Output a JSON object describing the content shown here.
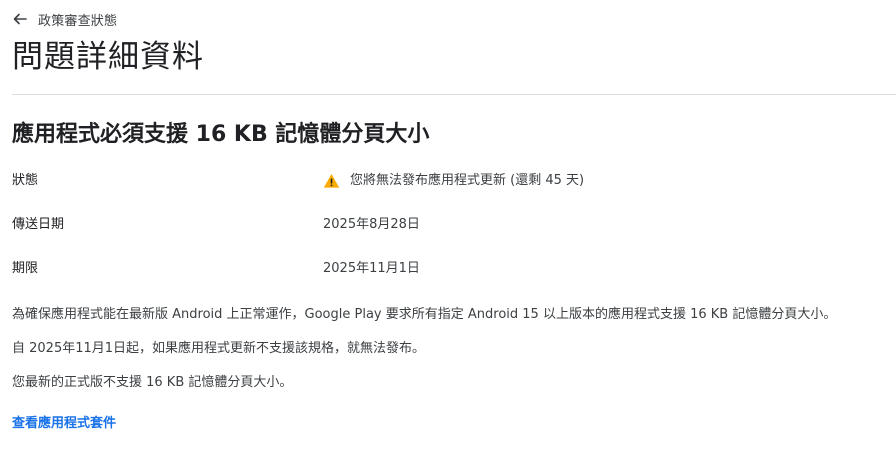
{
  "header": {
    "back_label": "政策審查狀態",
    "title": "問題詳細資料"
  },
  "issue": {
    "title": "應用程式必須支援 16 KB 記憶體分頁大小",
    "rows": [
      {
        "label": "狀態",
        "value": "您將無法發布應用程式更新 (還剩 45 天)"
      },
      {
        "label": "傳送日期",
        "value": "2025年8月28日"
      },
      {
        "label": "期限",
        "value": "2025年11月1日"
      }
    ],
    "paragraphs": [
      "為確保應用程式能在最新版 Android 上正常運作，Google Play 要求所有指定 Android 15 以上版本的應用程式支援 16 KB 記憶體分頁大小。",
      "自 2025年11月1日起，如果應用程式更新不支援該規格，就無法發布。",
      "您最新的正式版不支援 16 KB 記憶體分頁大小。"
    ],
    "link_label": "查看應用程式套件"
  },
  "colors": {
    "warning": "#f9ab00",
    "link": "#1a73e8",
    "divider": "#dadce0"
  },
  "icons": {
    "back": "arrow-back-icon",
    "status": "warning-icon"
  }
}
